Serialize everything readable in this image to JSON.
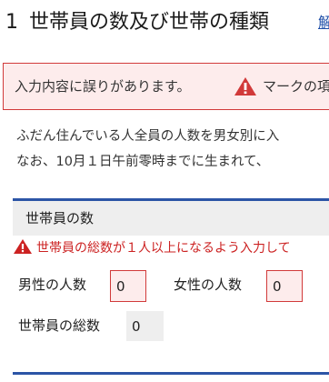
{
  "section": {
    "number": "1",
    "title": "世帯員の数及び世帯の種類",
    "help_link_fragment": "解"
  },
  "error_banner": {
    "message": "入力内容に誤りがあります。",
    "icon": "warning-triangle-icon",
    "trailing_text": "マークの項"
  },
  "intro": {
    "line1": "ふだん住んでいる人全員の人数を男女別に入",
    "line2": "なお、10月１日午前零時までに生まれて、"
  },
  "panel": {
    "header": "世帯員の数",
    "error_text": "世帯員の総数が１人以上になるよう入力して",
    "male_label": "男性の人数",
    "male_value": "0",
    "female_label": "女性の人数",
    "female_value": "0",
    "total_label": "世帯員の総数",
    "total_value": "0"
  },
  "colors": {
    "error_red": "#d13a3a",
    "error_bg": "#fdecec",
    "accent_blue": "#2c55a6",
    "header_gray": "#eeeeee"
  }
}
